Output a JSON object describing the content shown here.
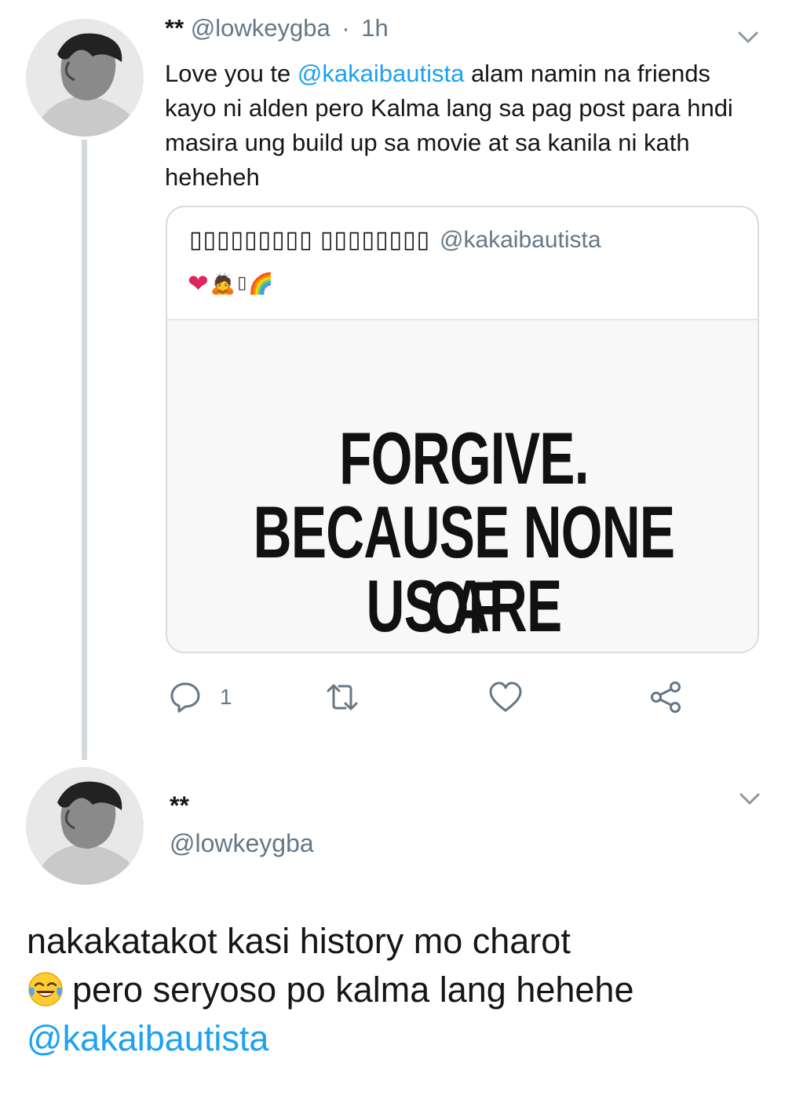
{
  "tweet1": {
    "display_name": "**",
    "handle": "@lowkeygba",
    "separator": "·",
    "time": "1h",
    "text_before_mention": "Love you te ",
    "mention": "@kakaibautista",
    "text_after_mention": " alam namin na friends kayo ni alden pero Kalma lang sa pag post para hndi masira ung build up sa movie at sa kanila ni kath heheheh",
    "avatar_icon": "profile-photo",
    "menu_icon": "chevron-down-icon"
  },
  "quoted_tweet": {
    "display_name_glyphs": "▯▯▯▯▯▯▯▯▯ ▯▯▯▯▯▯▯▯",
    "handle": "@kakaibautista",
    "emoji_heart": "❤",
    "emoji_person": "🙇",
    "emoji_unknown": "▯",
    "emoji_rainbow": "🌈",
    "image_text": {
      "line1": "FORGIVE.",
      "line2": "BECAUSE NONE OF",
      "line3": "US ARE PERFECT."
    }
  },
  "actions": {
    "reply_icon": "reply-icon",
    "reply_count": "1",
    "retweet_icon": "retweet-icon",
    "like_icon": "heart-icon",
    "share_icon": "share-icon"
  },
  "tweet2": {
    "display_name": "**",
    "handle": "@lowkeygba",
    "line1": "nakakatakot kasi history mo charot",
    "emoji": "😂",
    "line2": "pero seryoso po kalma lang hehehe",
    "mention": "@kakaibautista",
    "menu_icon": "chevron-down-icon"
  },
  "colors": {
    "link": "#1da1f2",
    "secondary_text": "#657786",
    "primary_text": "#14171a",
    "thread_line": "#d4d9de",
    "border": "#d7dce1"
  }
}
